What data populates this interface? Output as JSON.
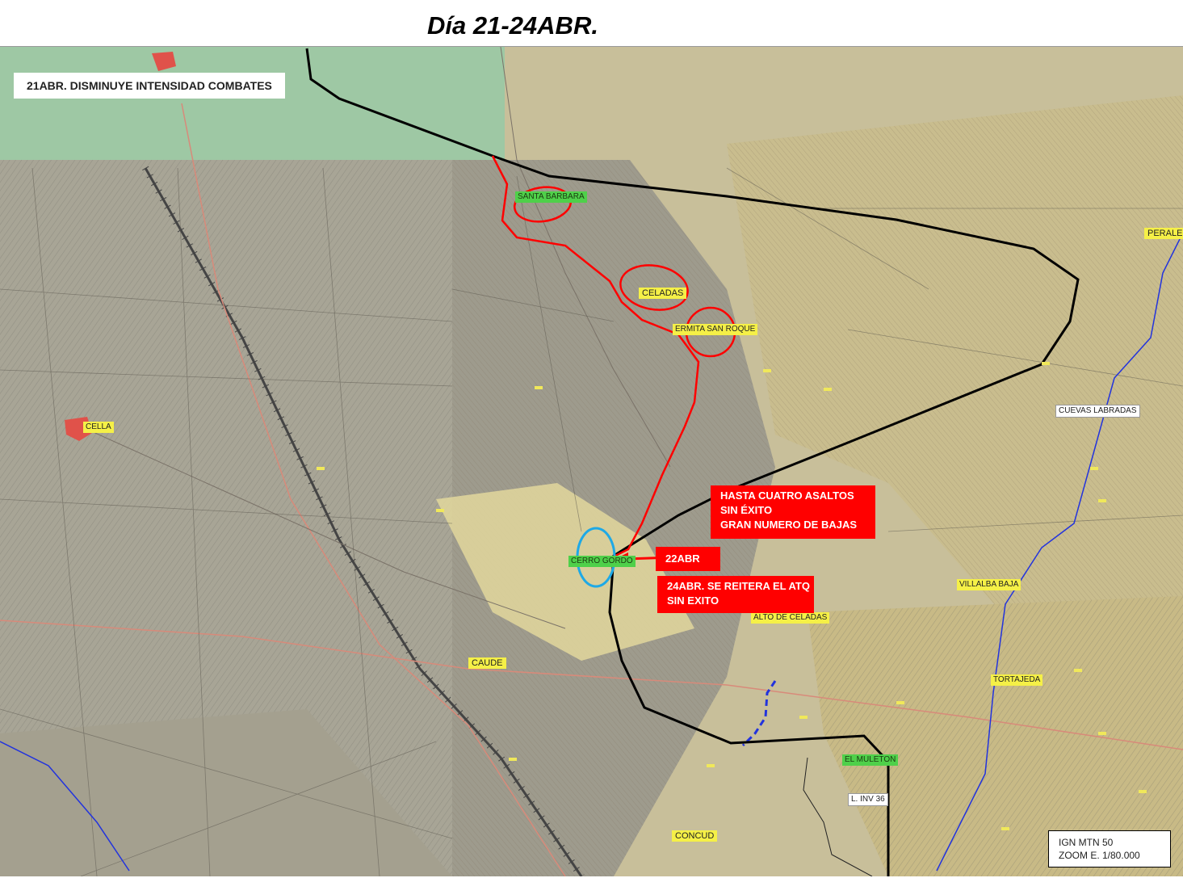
{
  "title": "Día 21-24ABR.",
  "headline": "21ABR. DISMINUYE INTENSIDAD COMBATES",
  "callouts": {
    "assaults": [
      "HASTA CUATRO ASALTOS",
      "SIN ÉXITO",
      "GRAN NUMERO DE BAJAS"
    ],
    "date_22": "22ABR",
    "date_24": [
      "24ABR. SE REITERA EL ATQ",
      "SIN EXITO"
    ]
  },
  "places": {
    "santa_barbara": "SANTA BARBARA",
    "celadas": "CELADAS",
    "san_roque": "ERMITA SAN ROQUE",
    "cella": "CELLA",
    "peralejos": "PERALE",
    "cuevas_labradas": "CUEVAS LABRADAS",
    "cerro_gordo": "CERRO GORDO",
    "villalba_baja": "VILLALBA BAJA",
    "alto_celadas": "ALTO DE CELADAS",
    "caude": "CAUDE",
    "tortajeda": "TORTAJEDA",
    "el_muleton": "EL MULETON",
    "inv36": "L. INV 36",
    "concud": "CONCUD"
  },
  "legend": {
    "source": "IGN MTN 50",
    "zoom": "ZOOM E. 1/80.000"
  },
  "colors": {
    "front_line": "#000000",
    "attack": "#ff0000",
    "objective": "#1ea9e6",
    "river": "#2233dd",
    "callout_bg": "#ff0000"
  }
}
